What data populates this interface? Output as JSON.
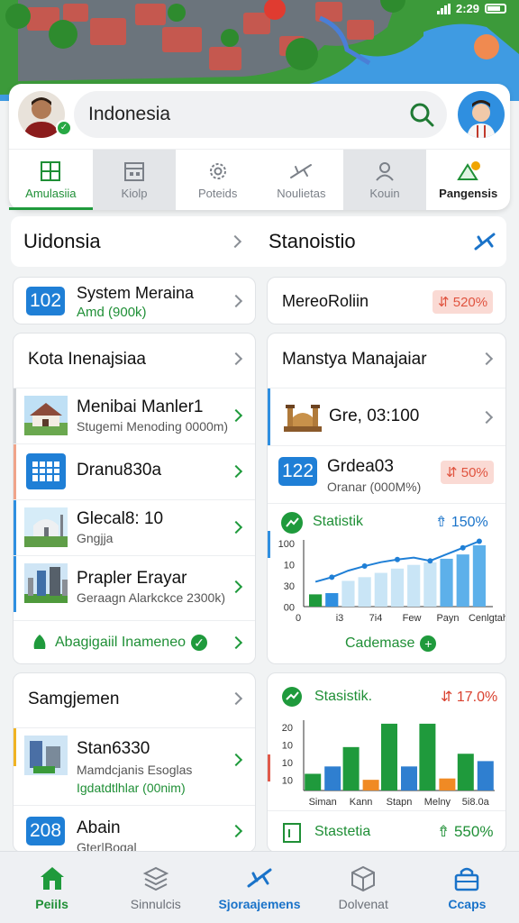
{
  "status_bar": {
    "time": "2:29"
  },
  "header": {
    "search_value": "Indonesia",
    "tabs": [
      {
        "label": "Amulasiia",
        "icon": "grid-icon"
      },
      {
        "label": "Kiolp",
        "icon": "building-icon"
      },
      {
        "label": "Poteids",
        "icon": "gear-icon"
      },
      {
        "label": "Noulietas",
        "icon": "airplane-icon"
      },
      {
        "label": "Kouin",
        "icon": "user-icon"
      },
      {
        "label": "Pangensis",
        "icon": "chart-icon"
      }
    ]
  },
  "sections": {
    "left_title": "Uidonsia",
    "right_title": "Stanoistio"
  },
  "system_card": {
    "badge": "102",
    "title": "System Meraina",
    "subtitle": "Amd (900k)"
  },
  "mereo_card": {
    "title": "MereoRoliin",
    "percent": "520%"
  },
  "kota_card": {
    "title": "Kota Inenajsiaa",
    "rows": [
      {
        "title": "Menibai Manler1",
        "subtitle": "Stugemi Menoding 0000m)",
        "thumb": "house-image"
      },
      {
        "title": "Dranu830a",
        "subtitle": "",
        "thumb": "calendar-icon"
      },
      {
        "title": "Glecal8: 10",
        "subtitle": "Gngjja",
        "thumb": "mosque-image"
      },
      {
        "title": "Prapler Erayar",
        "subtitle": "Geraagn Alarkckce 2300k)",
        "thumb": "city-image"
      }
    ],
    "link": "Abagigaiil Inameneo"
  },
  "manstya_card": {
    "title": "Manstya Manajaiar",
    "row1_title": "Gre, 03:100",
    "badge": "122",
    "row2_title": "Grdea03",
    "row2_subtitle": "Oranar (000M%)",
    "row2_percent": "50%",
    "chart_title": "Statistik",
    "chart_pct": "150%",
    "link": "Cademase"
  },
  "samgjemen_card": {
    "title": "Samgjemen",
    "row1_title": "Stan6330",
    "row1_sub1": "Mamdcjanis Esoglas",
    "row1_sub2": "Igdatdtlhlar (00nim)",
    "badge": "208",
    "row2_title": "Abain",
    "row2_sub": "Gter|Boqal"
  },
  "statistik2_card": {
    "title": "Stasistik.",
    "pct": "17.0%",
    "footer_title": "Stastetia",
    "footer_pct": "550%"
  },
  "chart_data": [
    {
      "type": "bar",
      "title": "Statistik",
      "yticks": [
        "100",
        "10",
        "30",
        "00"
      ],
      "xticks": [
        "0",
        "i3",
        "7i4",
        "Few",
        "Payn",
        "Cenlgtah"
      ],
      "series": [
        {
          "values": [
            20,
            22,
            0,
            0,
            0,
            0,
            0,
            0,
            0,
            0,
            0
          ]
        },
        {
          "values": [
            0,
            0,
            42,
            48,
            55,
            62,
            68,
            72,
            78,
            85,
            100
          ]
        },
        {
          "values": [
            38,
            45,
            55,
            62,
            68,
            72,
            75,
            70,
            80,
            90,
            100
          ]
        }
      ]
    },
    {
      "type": "bar",
      "title": "Stasistik.",
      "yticks": [
        "20",
        "10",
        "10",
        "10"
      ],
      "xticks": [
        "Siman",
        "Kann",
        "Stapn",
        "Melny",
        "5i8.0a"
      ],
      "series": [
        {
          "values": [
            25,
            65,
            100,
            100,
            55
          ]
        },
        {
          "values": [
            36,
            0,
            36,
            0,
            44
          ]
        },
        {
          "values": [
            0,
            16,
            0,
            18,
            0
          ]
        }
      ]
    }
  ],
  "bottom_nav": [
    {
      "label": "Peiils",
      "icon": "home-icon"
    },
    {
      "label": "Sinnulcis",
      "icon": "layers-icon"
    },
    {
      "label": "Sjoraajemens",
      "icon": "airplane-icon"
    },
    {
      "label": "Dolvenat",
      "icon": "box-icon"
    },
    {
      "label": "Ccaps",
      "icon": "bag-icon"
    }
  ]
}
